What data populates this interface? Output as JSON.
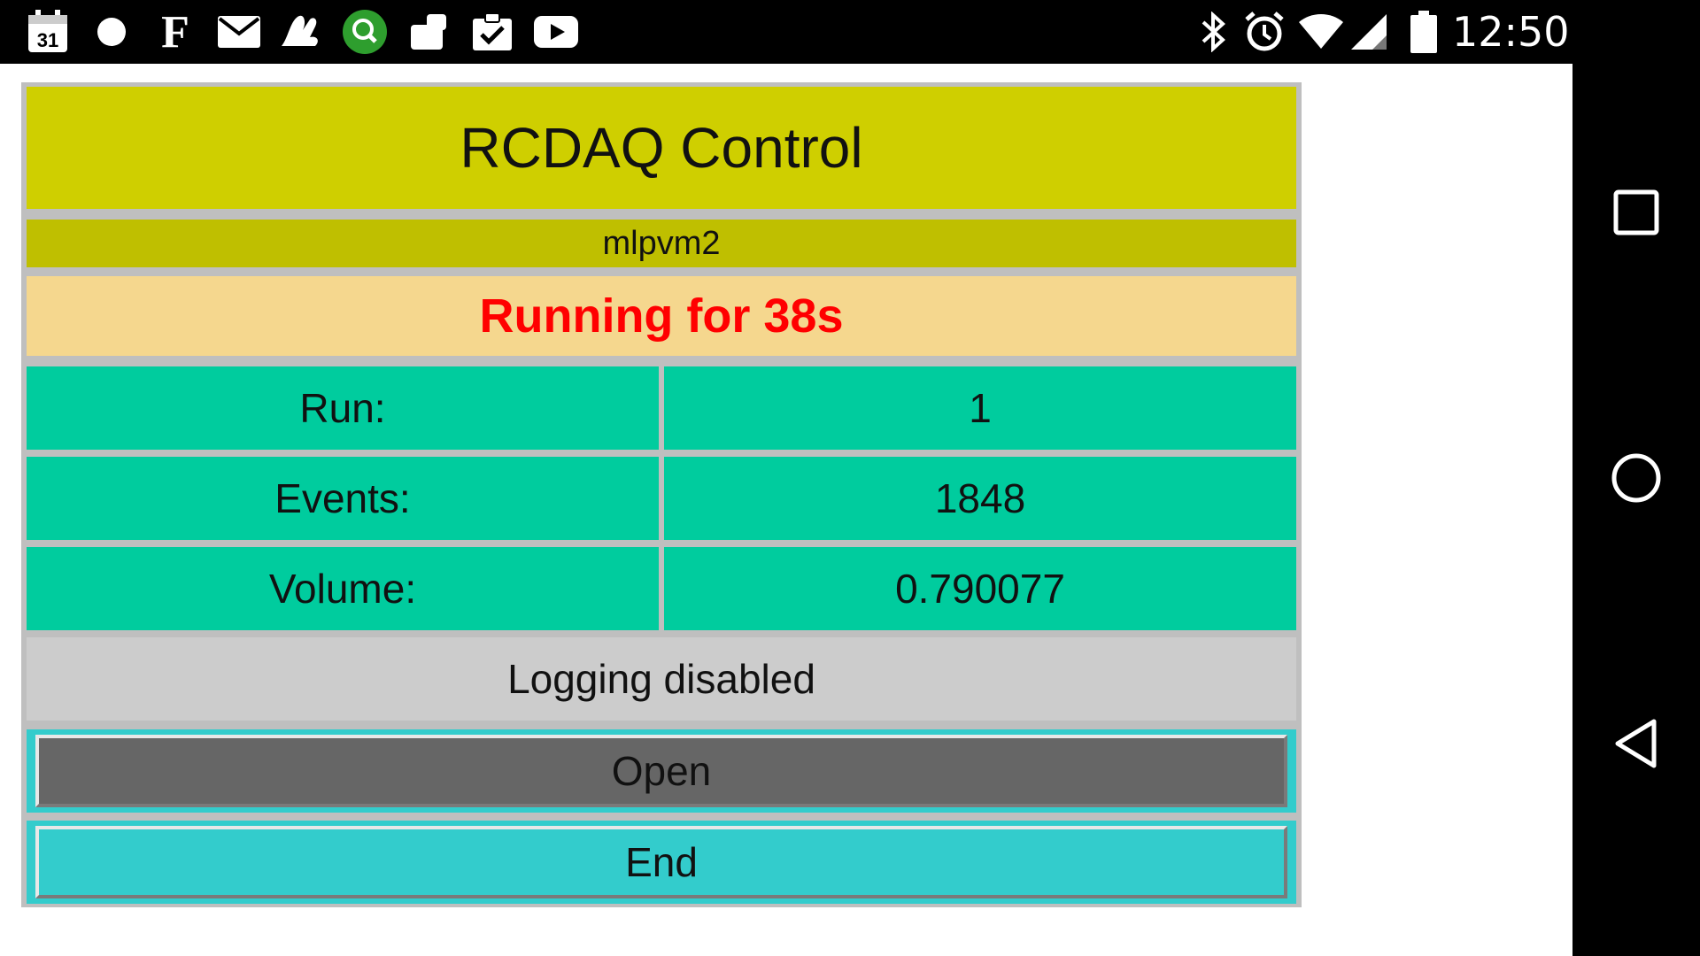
{
  "status_bar": {
    "calendar_day": "31",
    "news_letter": "F",
    "time": "12:50",
    "icons": [
      "calendar-icon",
      "circle-icon",
      "news-icon",
      "mail-icon",
      "hand-icon",
      "search-icon",
      "dropbox-icon",
      "clipboard-check-icon",
      "youtube-icon",
      "bluetooth-icon",
      "alarm-icon",
      "wifi-icon",
      "cell-signal-icon",
      "battery-icon"
    ]
  },
  "app": {
    "title": "RCDAQ Control",
    "host": "mlpvm2",
    "run_status": "Running for 38s",
    "rows": [
      {
        "label": "Run:",
        "value": "1"
      },
      {
        "label": "Events:",
        "value": "1848"
      },
      {
        "label": "Volume:",
        "value": "0.790077"
      }
    ],
    "logging": "Logging disabled",
    "buttons": {
      "open": "Open",
      "end": "End"
    }
  },
  "nav": {
    "icons": [
      "recents-icon",
      "home-icon",
      "back-icon"
    ]
  },
  "colors": {
    "title_bg": "#cfcf00",
    "host_bg": "#bfbf00",
    "status_bg": "#f5d78e",
    "status_text": "#ff0000",
    "row_bg": "#00cc9e",
    "logging_bg": "#cccccc",
    "open_bg": "#666666",
    "end_bg": "#33cccc"
  }
}
